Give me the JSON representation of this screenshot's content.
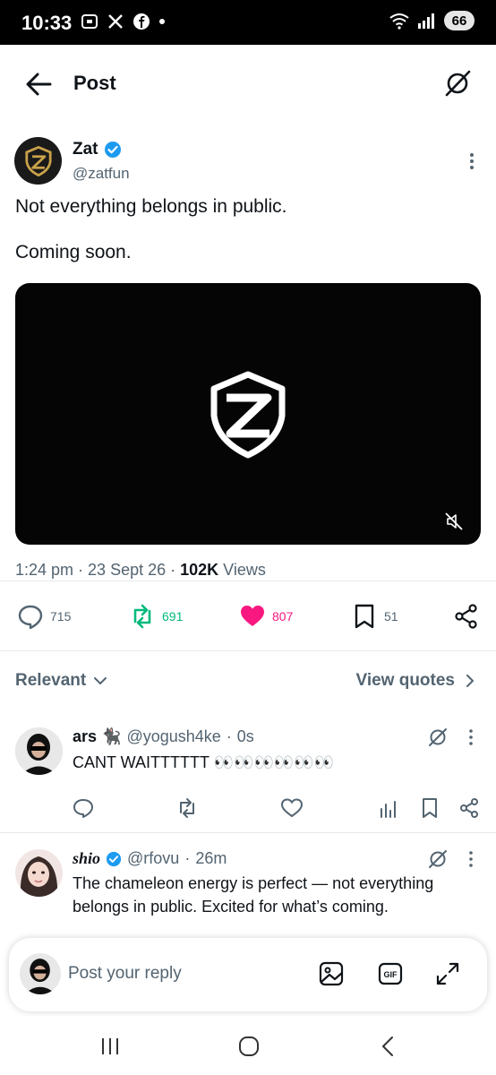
{
  "status_bar": {
    "time": "10:33",
    "battery": "66"
  },
  "header": {
    "title": "Post"
  },
  "post": {
    "author_name": "Zat",
    "author_handle": "@zatfun",
    "text_line1": "Not everything belongs in public.",
    "text_line2": "Coming soon.",
    "time": "1:24 pm",
    "date": "23 Sept 26",
    "views_count": "102K",
    "views_label": "Views",
    "replies": "715",
    "reposts": "691",
    "likes": "807",
    "bookmarks": "51"
  },
  "sort": {
    "relevant_label": "Relevant",
    "quotes_label": "View quotes"
  },
  "replies": [
    {
      "name": "ars 🐈‍⬛",
      "handle": "@yogush4ke",
      "time": "0s",
      "text": "CANT WAITTTTTT 👀👀👀👀👀👀"
    },
    {
      "name": "shio",
      "handle": "@rfovu",
      "time": "26m",
      "text": "The chameleon energy is perfect — not everything belongs in public. Excited for what’s coming."
    }
  ],
  "composer": {
    "placeholder": "Post your reply"
  },
  "colors": {
    "accent": "#1d9bf0",
    "like": "#f91880",
    "repost": "#00ba7c",
    "muted": "#536471"
  },
  "icons": [
    "back-arrow-icon",
    "grok-icon",
    "verified-badge-icon",
    "more-icon",
    "mute-icon",
    "reply-icon",
    "repost-icon",
    "like-icon",
    "bookmark-icon",
    "share-icon",
    "chevron-down-icon",
    "chevron-right-icon",
    "analytics-icon",
    "image-icon",
    "gif-icon",
    "expand-icon"
  ]
}
